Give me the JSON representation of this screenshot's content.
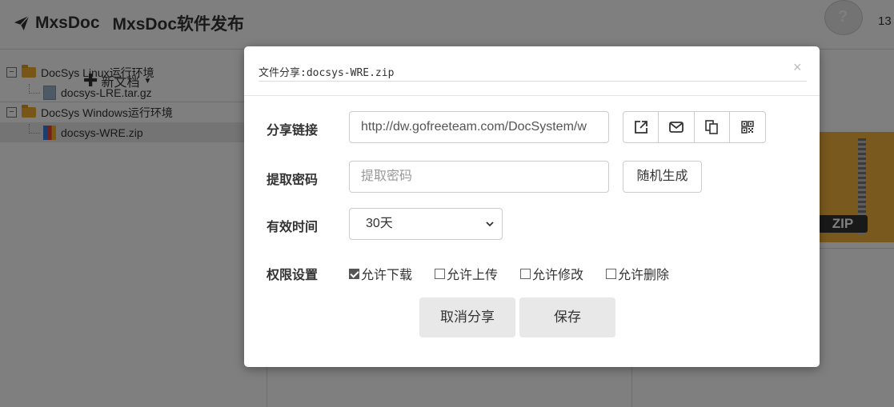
{
  "header": {
    "brand": "MxsDoc",
    "project_title": "MxsDoc软件发布",
    "user_name": "13"
  },
  "left": {
    "new_doc_label": "新文档",
    "tree": [
      {
        "label": "DocSys Linux运行环境",
        "type": "folder",
        "toggle": "−"
      },
      {
        "label": "docsys-LRE.tar.gz",
        "type": "file"
      },
      {
        "label": "DocSys Windows运行环境",
        "type": "folder",
        "toggle": "−"
      },
      {
        "label": "docsys-WRE.zip",
        "type": "file",
        "selected": true
      }
    ]
  },
  "preview": {
    "label": "ZIP"
  },
  "modal": {
    "title": "文件分享:docsys-WRE.zip",
    "close": "×",
    "share_link_label": "分享链接",
    "share_link_value": "http://dw.gofreeteam.com/DocSystem/w",
    "password_label": "提取密码",
    "password_placeholder": "提取密码",
    "random_button": "随机生成",
    "expire_label": "有效时间",
    "expire_value": "30天",
    "permissions_label": "权限设置",
    "permissions": [
      {
        "label": "允许下载",
        "checked": true
      },
      {
        "label": "允许上传",
        "checked": false
      },
      {
        "label": "允许修改",
        "checked": false
      },
      {
        "label": "允许删除",
        "checked": false
      }
    ],
    "cancel_share_button": "取消分享",
    "save_button": "保存",
    "link_actions": [
      "open-link-icon",
      "email-icon",
      "copy-icon",
      "qrcode-icon"
    ]
  }
}
